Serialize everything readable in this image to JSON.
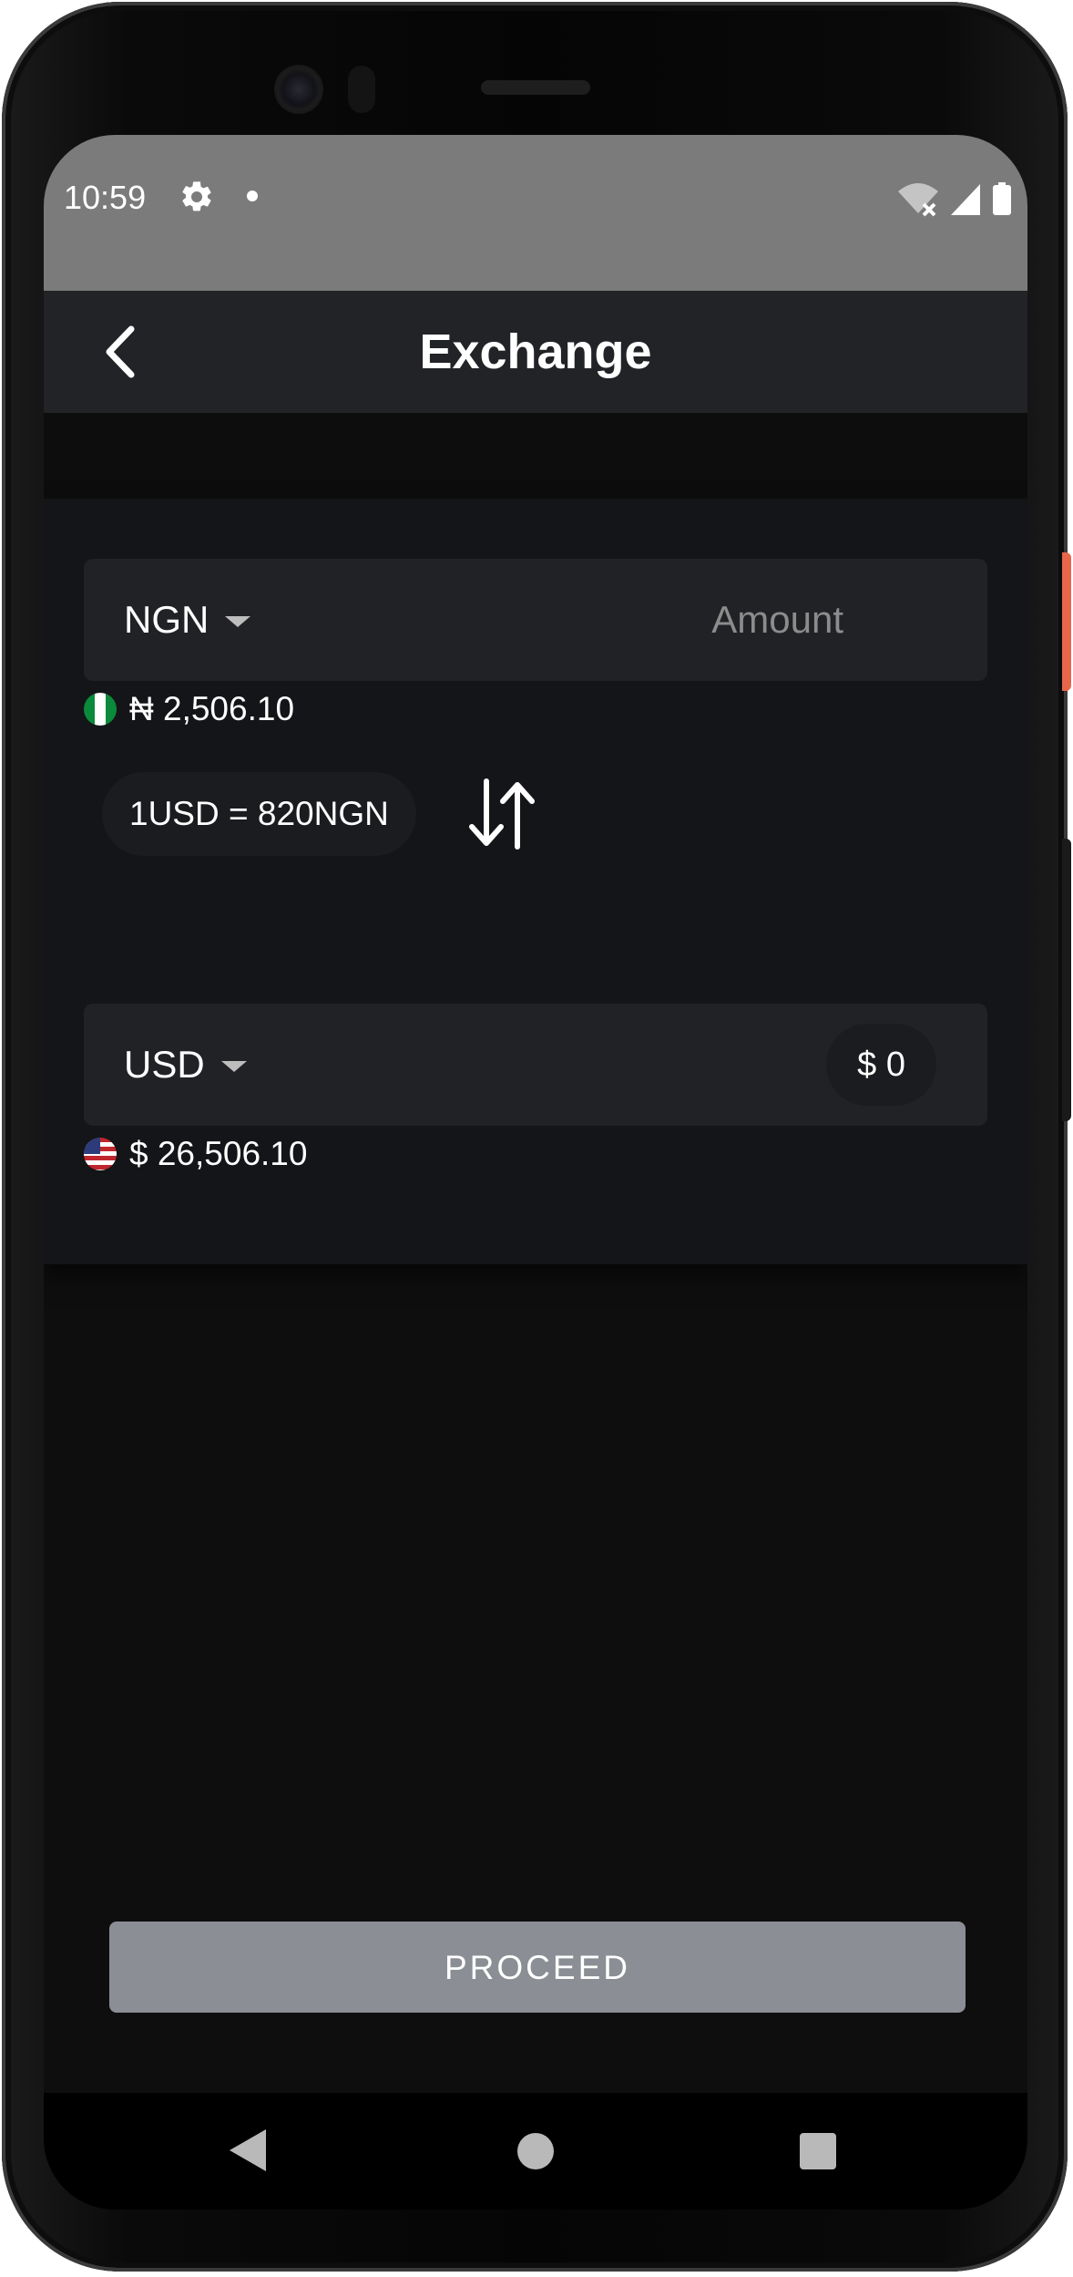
{
  "status_bar": {
    "time": "10:59",
    "icons": [
      "gear-icon",
      "notification-dot-icon",
      "wifi-off-icon",
      "signal-icon",
      "battery-icon"
    ]
  },
  "app_bar": {
    "title": "Exchange",
    "back_icon": "chevron-left-icon"
  },
  "exchange": {
    "from": {
      "currency": "NGN",
      "amount_placeholder": "Amount",
      "balance": "₦ 2,506.10",
      "flag_icon": "nigeria-flag-icon"
    },
    "rate": "1USD = 820NGN",
    "swap_icon": "swap-vertical-icon",
    "to": {
      "currency": "USD",
      "amount": "$ 0",
      "balance": "$ 26,506.10",
      "flag_icon": "us-flag-icon"
    }
  },
  "proceed_label": "PROCEED",
  "nav_bar": {
    "icons": [
      "nav-back-icon",
      "nav-home-icon",
      "nav-recents-icon"
    ]
  },
  "colors": {
    "status_bar_bg": "#7b7b7b",
    "app_bar_bg": "#222326",
    "card_bg": "#141518",
    "field_bg": "#212226",
    "screen_bg": "#0e0e0e",
    "proceed_bg": "#8b8e94",
    "side_button_accent": "#e8664a"
  }
}
